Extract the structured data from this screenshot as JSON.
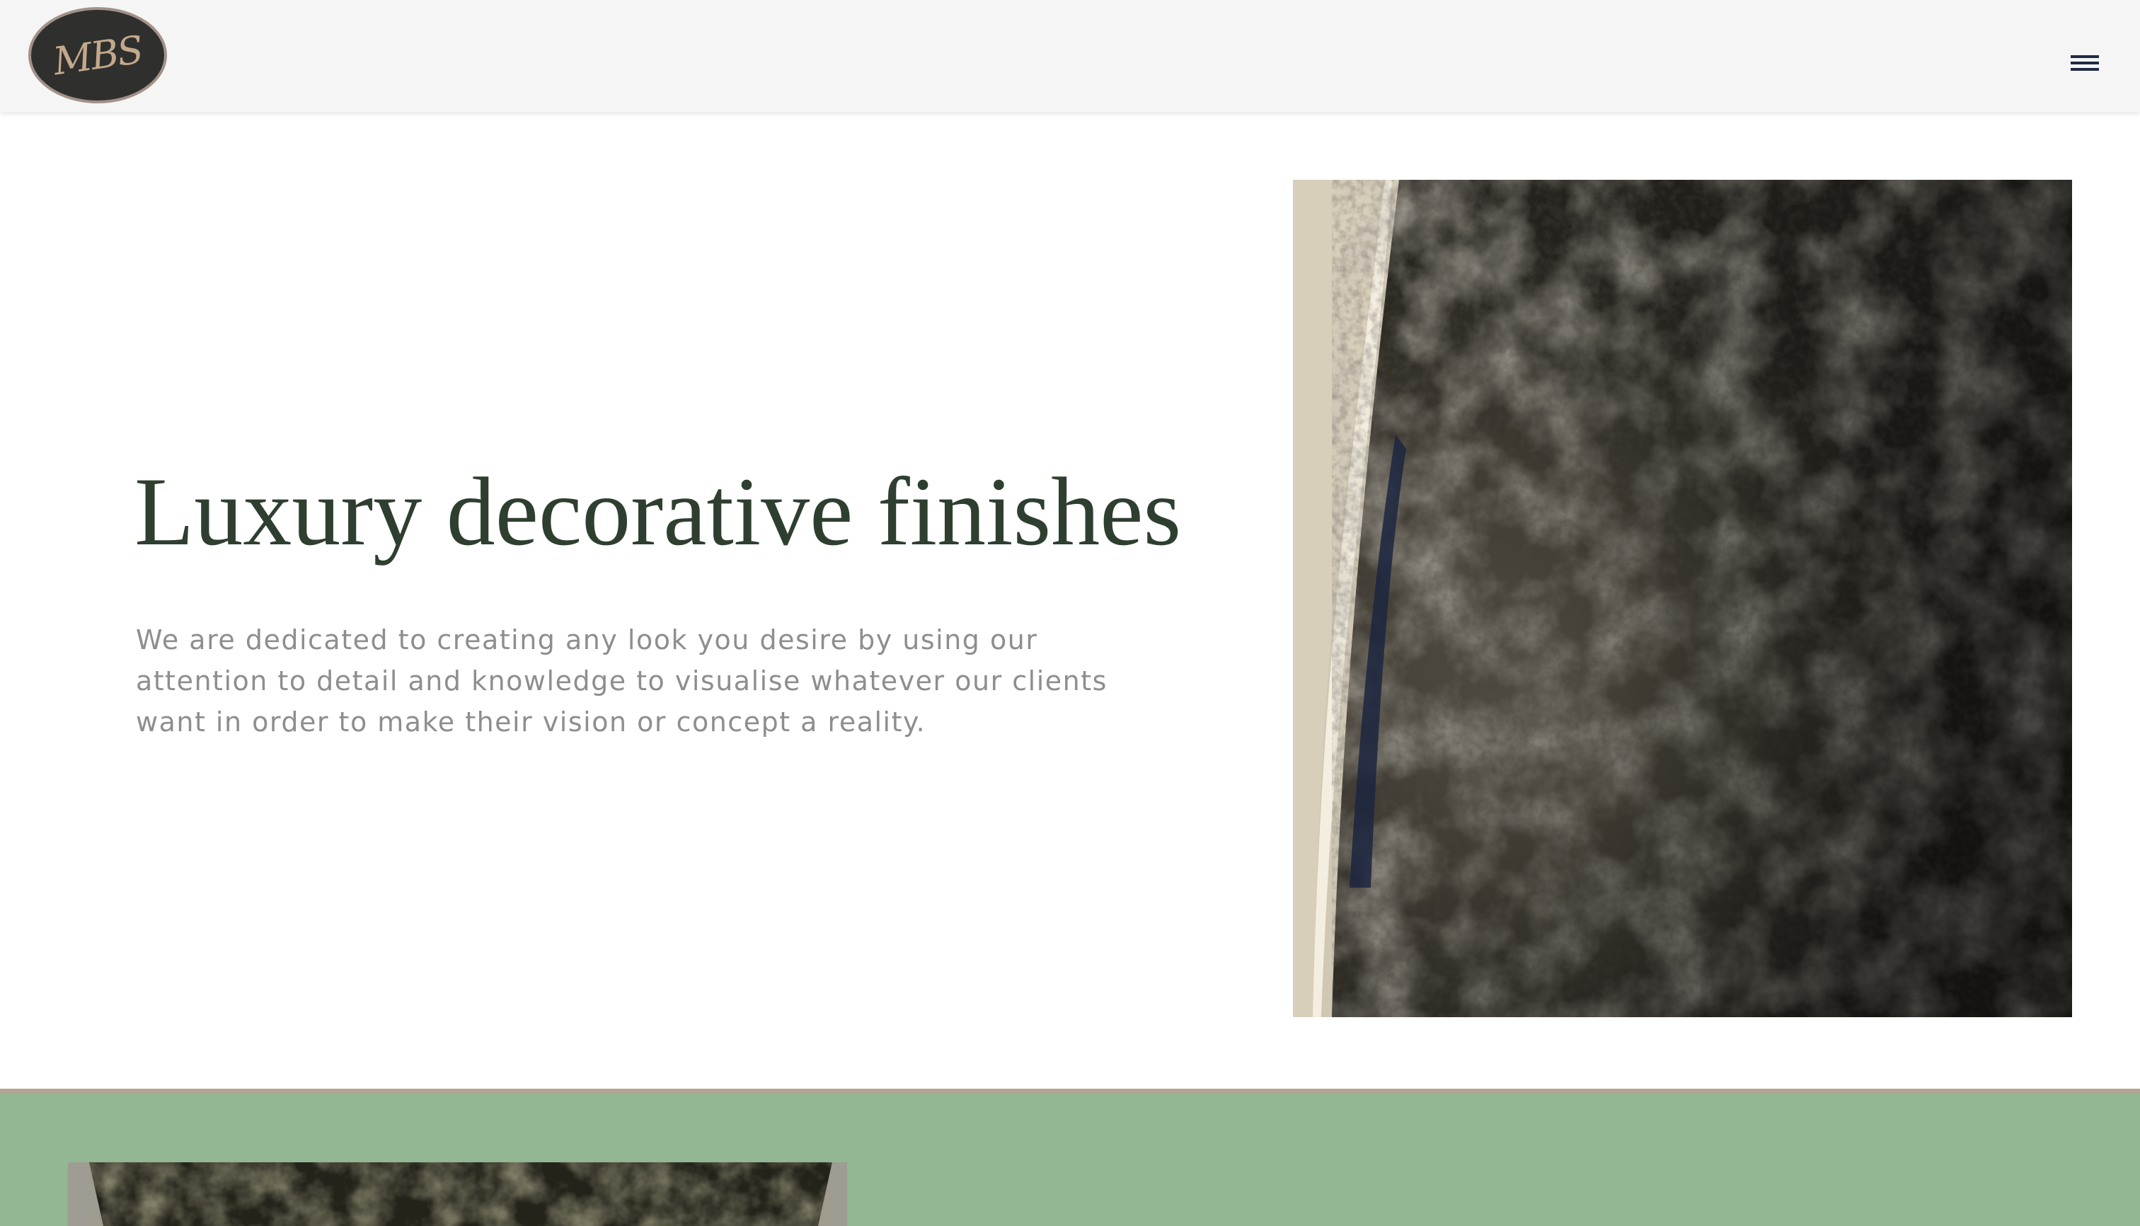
{
  "header": {
    "logo_text": "MBS",
    "menu_icon": "hamburger-menu-icon"
  },
  "hero": {
    "title": "Luxury decorative finishes",
    "description": "We are dedicated to creating any look you desire by using our attention to detail and knowledge to visualise whatever our clients want in order to make their vision or concept a reality."
  },
  "colors": {
    "header_bg": "#f5f5f5",
    "logo_bg": "#2f2f2e",
    "logo_text": "#c2a98a",
    "title": "#2e3f30",
    "body_text": "#8e8e8e",
    "green_section": "#93b793",
    "section_divider": "#b3a592"
  }
}
